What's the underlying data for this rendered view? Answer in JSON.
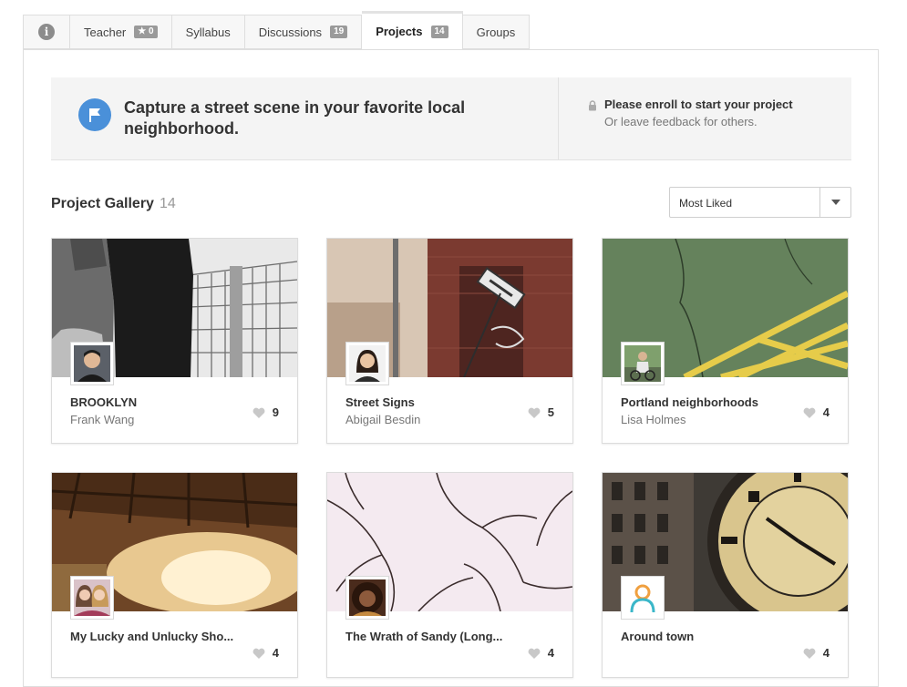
{
  "tabs": [
    {
      "label": "",
      "icon": "info-icon"
    },
    {
      "label": "Teacher",
      "badge": "★ 0"
    },
    {
      "label": "Syllabus"
    },
    {
      "label": "Discussions",
      "badge": "19"
    },
    {
      "label": "Projects",
      "badge": "14",
      "active": true
    },
    {
      "label": "Groups"
    }
  ],
  "prompt": {
    "title": "Capture a street scene in your favorite local neighborhood.",
    "enroll_title": "Please enroll to start your project",
    "enroll_sub": "Or leave feedback for others."
  },
  "gallery": {
    "title": "Project Gallery",
    "count": "14",
    "sort_selected": "Most Liked"
  },
  "projects": [
    {
      "title": "BROOKLYN",
      "author": "Frank Wang",
      "likes": "9"
    },
    {
      "title": "Street Signs",
      "author": "Abigail Besdin",
      "likes": "5"
    },
    {
      "title": "Portland neighborhoods",
      "author": "Lisa Holmes",
      "likes": "4"
    },
    {
      "title": "My Lucky and Unlucky Sho...",
      "author": "",
      "likes": "4"
    },
    {
      "title": "The Wrath of Sandy (Long...",
      "author": "",
      "likes": "4"
    },
    {
      "title": "Around town",
      "author": "",
      "likes": "4"
    }
  ],
  "colors": {
    "accent": "#4a90d9",
    "badge": "#9a9a9a",
    "heart": "#c8c8c8"
  }
}
